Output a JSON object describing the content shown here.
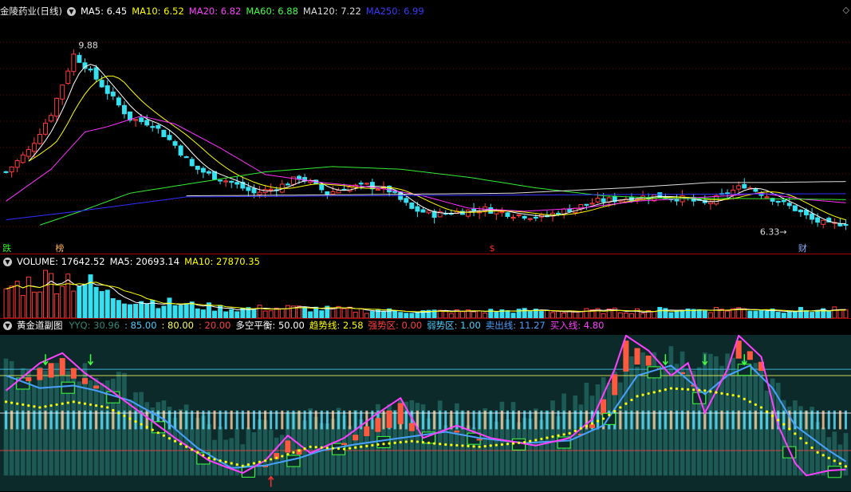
{
  "colors": {
    "bg": "#000000",
    "up": "#ff3b3b",
    "down": "#36e0f0",
    "ma5": "#ffffff",
    "ma10": "#ffff00",
    "ma20": "#ff30ff",
    "ma60": "#33ee33",
    "ma120": "#dddddd",
    "ma250": "#3030ff",
    "grid": "#7a0000"
  },
  "main": {
    "title": "金陵药业(日线)",
    "ma": [
      {
        "label": "MA5: 6.45",
        "color": "#ffffff"
      },
      {
        "label": "MA10: 6.52",
        "color": "#ffff00"
      },
      {
        "label": "MA20: 6.82",
        "color": "#ff40ff"
      },
      {
        "label": "MA60: 6.88",
        "color": "#44ff44"
      },
      {
        "label": "MA120: 7.22",
        "color": "#dddddd"
      },
      {
        "label": "MA250: 6.99",
        "color": "#3a3aff"
      }
    ],
    "high_label": "9.88",
    "low_label": "6.33",
    "markers": [
      {
        "text": "跌",
        "color": "#33ee33",
        "x": 0.003
      },
      {
        "text": "榜",
        "color": "#ffb050",
        "x": 0.065
      },
      {
        "text": "$",
        "color": "#ff3030",
        "x": 0.575
      },
      {
        "text": "财",
        "color": "#8ab0ff",
        "x": 0.938
      }
    ],
    "diamond_icon": "◇"
  },
  "volume": {
    "legend": [
      {
        "label": "VOLUME: 17642.52",
        "color": "#ffffff"
      },
      {
        "label": "MA5: 20693.14",
        "color": "#ffffff"
      },
      {
        "label": "MA10: 27870.35",
        "color": "#ffff00"
      }
    ]
  },
  "indicator": {
    "title": "黄金道副图",
    "legend": [
      {
        "label": "YYQ: 30.96",
        "color": "#2e8b7a"
      },
      {
        "label": ": 85.00",
        "color": "#48d0ff"
      },
      {
        "label": ": 80.00",
        "color": "#ffff60"
      },
      {
        "label": ": 20.00",
        "color": "#ff4040"
      },
      {
        "label": "多空平衡: 50.00",
        "color": "#ffffff"
      },
      {
        "label": "趋势线: 2.58",
        "color": "#ffff00"
      },
      {
        "label": "强势区: 0.00",
        "color": "#ff4040"
      },
      {
        "label": "弱势区: 1.00",
        "color": "#48d0ff"
      },
      {
        "label": "卖出线: 11.27",
        "color": "#48a0ff"
      },
      {
        "label": "买入线: 4.80",
        "color": "#ff40ff"
      }
    ]
  },
  "chart_data": {
    "type": "line",
    "x_count": 150,
    "ylim": [
      6.0,
      10.0
    ],
    "close_keypoints": [
      [
        0,
        7.4
      ],
      [
        4,
        7.8
      ],
      [
        8,
        8.5
      ],
      [
        12,
        9.6
      ],
      [
        14,
        9.4
      ],
      [
        18,
        8.9
      ],
      [
        22,
        8.4
      ],
      [
        26,
        8.3
      ],
      [
        30,
        7.9
      ],
      [
        33,
        7.5
      ],
      [
        36,
        7.35
      ],
      [
        40,
        7.2
      ],
      [
        44,
        7.0
      ],
      [
        48,
        7.1
      ],
      [
        52,
        7.3
      ],
      [
        54,
        7.2
      ],
      [
        57,
        7.0
      ],
      [
        60,
        7.1
      ],
      [
        64,
        7.15
      ],
      [
        68,
        7.05
      ],
      [
        72,
        6.7
      ],
      [
        76,
        6.6
      ],
      [
        80,
        6.65
      ],
      [
        85,
        6.7
      ],
      [
        90,
        6.6
      ],
      [
        95,
        6.55
      ],
      [
        100,
        6.7
      ],
      [
        105,
        6.85
      ],
      [
        110,
        6.9
      ],
      [
        115,
        6.95
      ],
      [
        120,
        6.9
      ],
      [
        124,
        6.8
      ],
      [
        128,
        7.0
      ],
      [
        131,
        7.15
      ],
      [
        134,
        7.0
      ],
      [
        137,
        6.85
      ],
      [
        140,
        6.7
      ],
      [
        143,
        6.5
      ],
      [
        146,
        6.4
      ],
      [
        149,
        6.45
      ]
    ],
    "ma20_keypoints": [
      [
        0,
        6.85
      ],
      [
        8,
        7.45
      ],
      [
        14,
        8.15
      ],
      [
        18,
        8.25
      ],
      [
        24,
        8.45
      ],
      [
        30,
        8.3
      ],
      [
        38,
        7.85
      ],
      [
        46,
        7.35
      ],
      [
        56,
        7.2
      ],
      [
        66,
        7.1
      ],
      [
        74,
        6.95
      ],
      [
        82,
        6.72
      ],
      [
        92,
        6.66
      ],
      [
        102,
        6.72
      ],
      [
        112,
        6.85
      ],
      [
        120,
        6.9
      ],
      [
        128,
        6.95
      ],
      [
        134,
        7.0
      ],
      [
        142,
        6.88
      ],
      [
        149,
        6.82
      ]
    ],
    "ma60_keypoints": [
      [
        6,
        6.4
      ],
      [
        13,
        6.65
      ],
      [
        22,
        7.0
      ],
      [
        34,
        7.2
      ],
      [
        46,
        7.4
      ],
      [
        58,
        7.5
      ],
      [
        70,
        7.45
      ],
      [
        82,
        7.3
      ],
      [
        94,
        7.1
      ],
      [
        106,
        6.95
      ],
      [
        118,
        6.9
      ],
      [
        130,
        6.9
      ],
      [
        140,
        6.89
      ],
      [
        149,
        6.88
      ]
    ],
    "ma120_keypoints": [
      [
        32,
        6.95
      ],
      [
        60,
        6.97
      ],
      [
        90,
        7.0
      ],
      [
        110,
        7.1
      ],
      [
        125,
        7.2
      ],
      [
        135,
        7.2
      ],
      [
        149,
        7.22
      ]
    ],
    "ma250_keypoints": [
      [
        0,
        6.5
      ],
      [
        12,
        6.65
      ],
      [
        32,
        6.93
      ],
      [
        80,
        6.96
      ],
      [
        120,
        6.98
      ],
      [
        149,
        6.99
      ]
    ],
    "volume_ylim": [
      0,
      100000
    ],
    "volume_keypoints": [
      [
        0,
        65000
      ],
      [
        6,
        80000
      ],
      [
        10,
        90000
      ],
      [
        14,
        78000
      ],
      [
        18,
        50000
      ],
      [
        22,
        42000
      ],
      [
        26,
        36000
      ],
      [
        32,
        28000
      ],
      [
        40,
        20000
      ],
      [
        50,
        22000
      ],
      [
        60,
        18000
      ],
      [
        70,
        15000
      ],
      [
        80,
        14000
      ],
      [
        90,
        16000
      ],
      [
        100,
        15000
      ],
      [
        110,
        16000
      ],
      [
        120,
        18000
      ],
      [
        130,
        20000
      ],
      [
        140,
        17000
      ],
      [
        149,
        17642.52
      ]
    ],
    "indicator_ylim": [
      -10,
      110
    ],
    "sell_keypoints": [
      [
        0,
        80
      ],
      [
        6,
        70
      ],
      [
        12,
        72
      ],
      [
        16,
        68
      ],
      [
        22,
        60
      ],
      [
        28,
        45
      ],
      [
        34,
        22
      ],
      [
        40,
        6
      ],
      [
        46,
        8
      ],
      [
        52,
        14
      ],
      [
        56,
        20
      ],
      [
        62,
        25
      ],
      [
        70,
        30
      ],
      [
        78,
        35
      ],
      [
        84,
        30
      ],
      [
        92,
        26
      ],
      [
        100,
        28
      ],
      [
        106,
        40
      ],
      [
        112,
        80
      ],
      [
        118,
        88
      ],
      [
        124,
        65
      ],
      [
        128,
        80
      ],
      [
        132,
        88
      ],
      [
        136,
        70
      ],
      [
        140,
        40
      ],
      [
        146,
        20
      ],
      [
        149,
        11.27
      ]
    ],
    "buy_keypoints": [
      [
        0,
        68
      ],
      [
        6,
        90
      ],
      [
        10,
        98
      ],
      [
        14,
        82
      ],
      [
        18,
        70
      ],
      [
        24,
        50
      ],
      [
        30,
        30
      ],
      [
        36,
        12
      ],
      [
        42,
        2
      ],
      [
        46,
        12
      ],
      [
        50,
        32
      ],
      [
        54,
        18
      ],
      [
        60,
        30
      ],
      [
        66,
        50
      ],
      [
        70,
        62
      ],
      [
        74,
        30
      ],
      [
        80,
        40
      ],
      [
        86,
        30
      ],
      [
        94,
        24
      ],
      [
        100,
        30
      ],
      [
        104,
        45
      ],
      [
        108,
        85
      ],
      [
        110,
        112
      ],
      [
        114,
        100
      ],
      [
        118,
        80
      ],
      [
        121,
        90
      ],
      [
        124,
        50
      ],
      [
        128,
        85
      ],
      [
        130,
        112
      ],
      [
        134,
        95
      ],
      [
        137,
        40
      ],
      [
        140,
        10
      ],
      [
        142,
        0
      ],
      [
        146,
        4
      ],
      [
        149,
        4.8
      ]
    ],
    "trend_keypoints": [
      [
        0,
        60
      ],
      [
        6,
        55
      ],
      [
        12,
        60
      ],
      [
        18,
        55
      ],
      [
        24,
        40
      ],
      [
        30,
        25
      ],
      [
        36,
        10
      ],
      [
        42,
        3
      ],
      [
        48,
        10
      ],
      [
        54,
        20
      ],
      [
        60,
        18
      ],
      [
        66,
        22
      ],
      [
        72,
        25
      ],
      [
        78,
        22
      ],
      [
        84,
        20
      ],
      [
        92,
        24
      ],
      [
        100,
        32
      ],
      [
        106,
        45
      ],
      [
        112,
        65
      ],
      [
        118,
        72
      ],
      [
        124,
        70
      ],
      [
        130,
        65
      ],
      [
        134,
        55
      ],
      [
        138,
        40
      ],
      [
        144,
        15
      ],
      [
        149,
        2.58
      ]
    ],
    "levels": [
      85,
      80,
      50,
      20
    ]
  }
}
